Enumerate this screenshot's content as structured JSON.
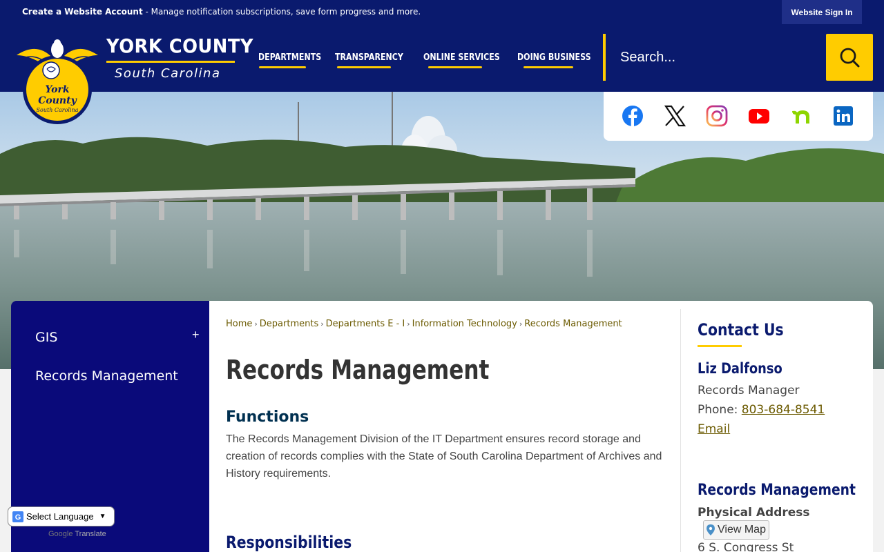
{
  "utility_bar": {
    "account_bold": "Create a Website Account",
    "account_text": " - Manage notification subscriptions, save form progress and more.",
    "sign_in": "Website Sign In"
  },
  "header": {
    "title": "YORK COUNTY",
    "subtitle": "South Carolina",
    "nav": [
      "DEPARTMENTS",
      "TRANSPARENCY",
      "ONLINE SERVICES",
      "DOING BUSINESS"
    ],
    "search_placeholder": "Search..."
  },
  "social": [
    "facebook-icon",
    "x-icon",
    "instagram-icon",
    "youtube-icon",
    "nextdoor-icon",
    "linkedin-icon"
  ],
  "sidebar": {
    "items": [
      {
        "label": "GIS",
        "expand": "+"
      },
      {
        "label": "Records Management"
      }
    ]
  },
  "main": {
    "breadcrumb": [
      "Home",
      "Departments",
      "Departments E - I",
      "Information Technology",
      "Records Management"
    ],
    "title": "Records Management",
    "functions_heading": "Functions",
    "functions_text": "The Records Management Division of the IT Department ensures record storage and creation of records complies with the State of South Carolina Department of Archives and History requirements.",
    "responsibilities_heading": "Responsibilities"
  },
  "contact": {
    "heading": "Contact Us",
    "name": "Liz Dalfonso",
    "role": "Records Manager",
    "phone_label": "Phone: ",
    "phone": "803-684-8541",
    "email": "Email",
    "dept_heading": "Records Management",
    "address_label": "Physical Address",
    "map_button": "View Map",
    "address_line": "6 S. Congress St"
  },
  "translate": {
    "label": "Select Language",
    "powered_by": "Google",
    "translate_word": "Translate"
  },
  "colors": {
    "navy": "#0a1a6e",
    "gold": "#ffcc00",
    "sidebar": "#0a0a7a",
    "link": "#6b5a00"
  }
}
